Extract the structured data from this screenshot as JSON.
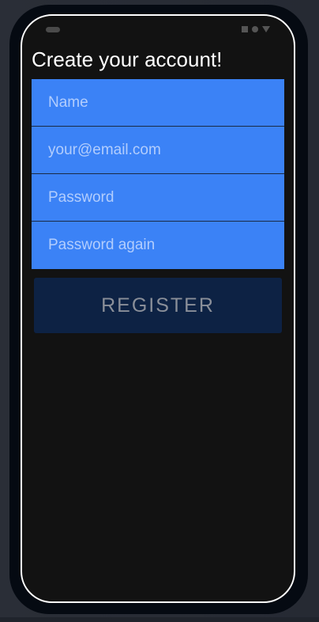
{
  "screen": {
    "title": "Create your account!"
  },
  "form": {
    "fields": [
      {
        "name": "name",
        "placeholder": "Name",
        "value": ""
      },
      {
        "name": "email",
        "placeholder": "your@email.com",
        "value": ""
      },
      {
        "name": "password",
        "placeholder": "Password",
        "value": ""
      },
      {
        "name": "password_again",
        "placeholder": "Password again",
        "value": ""
      }
    ],
    "register_label": "REGISTER"
  },
  "colors": {
    "field_bg": "#3b82f6",
    "button_bg": "#0d2244",
    "screen_bg": "#121212"
  }
}
